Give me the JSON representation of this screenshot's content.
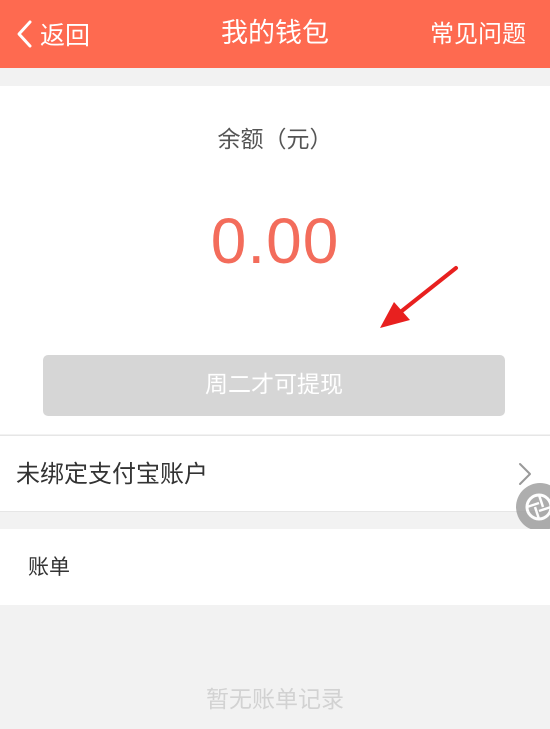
{
  "header": {
    "back_label": "返回",
    "title": "我的钱包",
    "faq_label": "常见问题",
    "bg_color": "#fe6a50"
  },
  "balance": {
    "label": "余额（元）",
    "amount": "0.00",
    "amount_color": "#f36c5b"
  },
  "withdraw": {
    "label": "周二才可提现",
    "disabled": true
  },
  "alipay": {
    "label": "未绑定支付宝账户"
  },
  "bills": {
    "label": "账单",
    "empty_text": "暂无账单记录"
  },
  "icons": {
    "back": "chevron-left-icon",
    "row_arrow": "chevron-right-icon",
    "float_ball": "aperture-icon",
    "annotation": "red-arrow-icon"
  }
}
